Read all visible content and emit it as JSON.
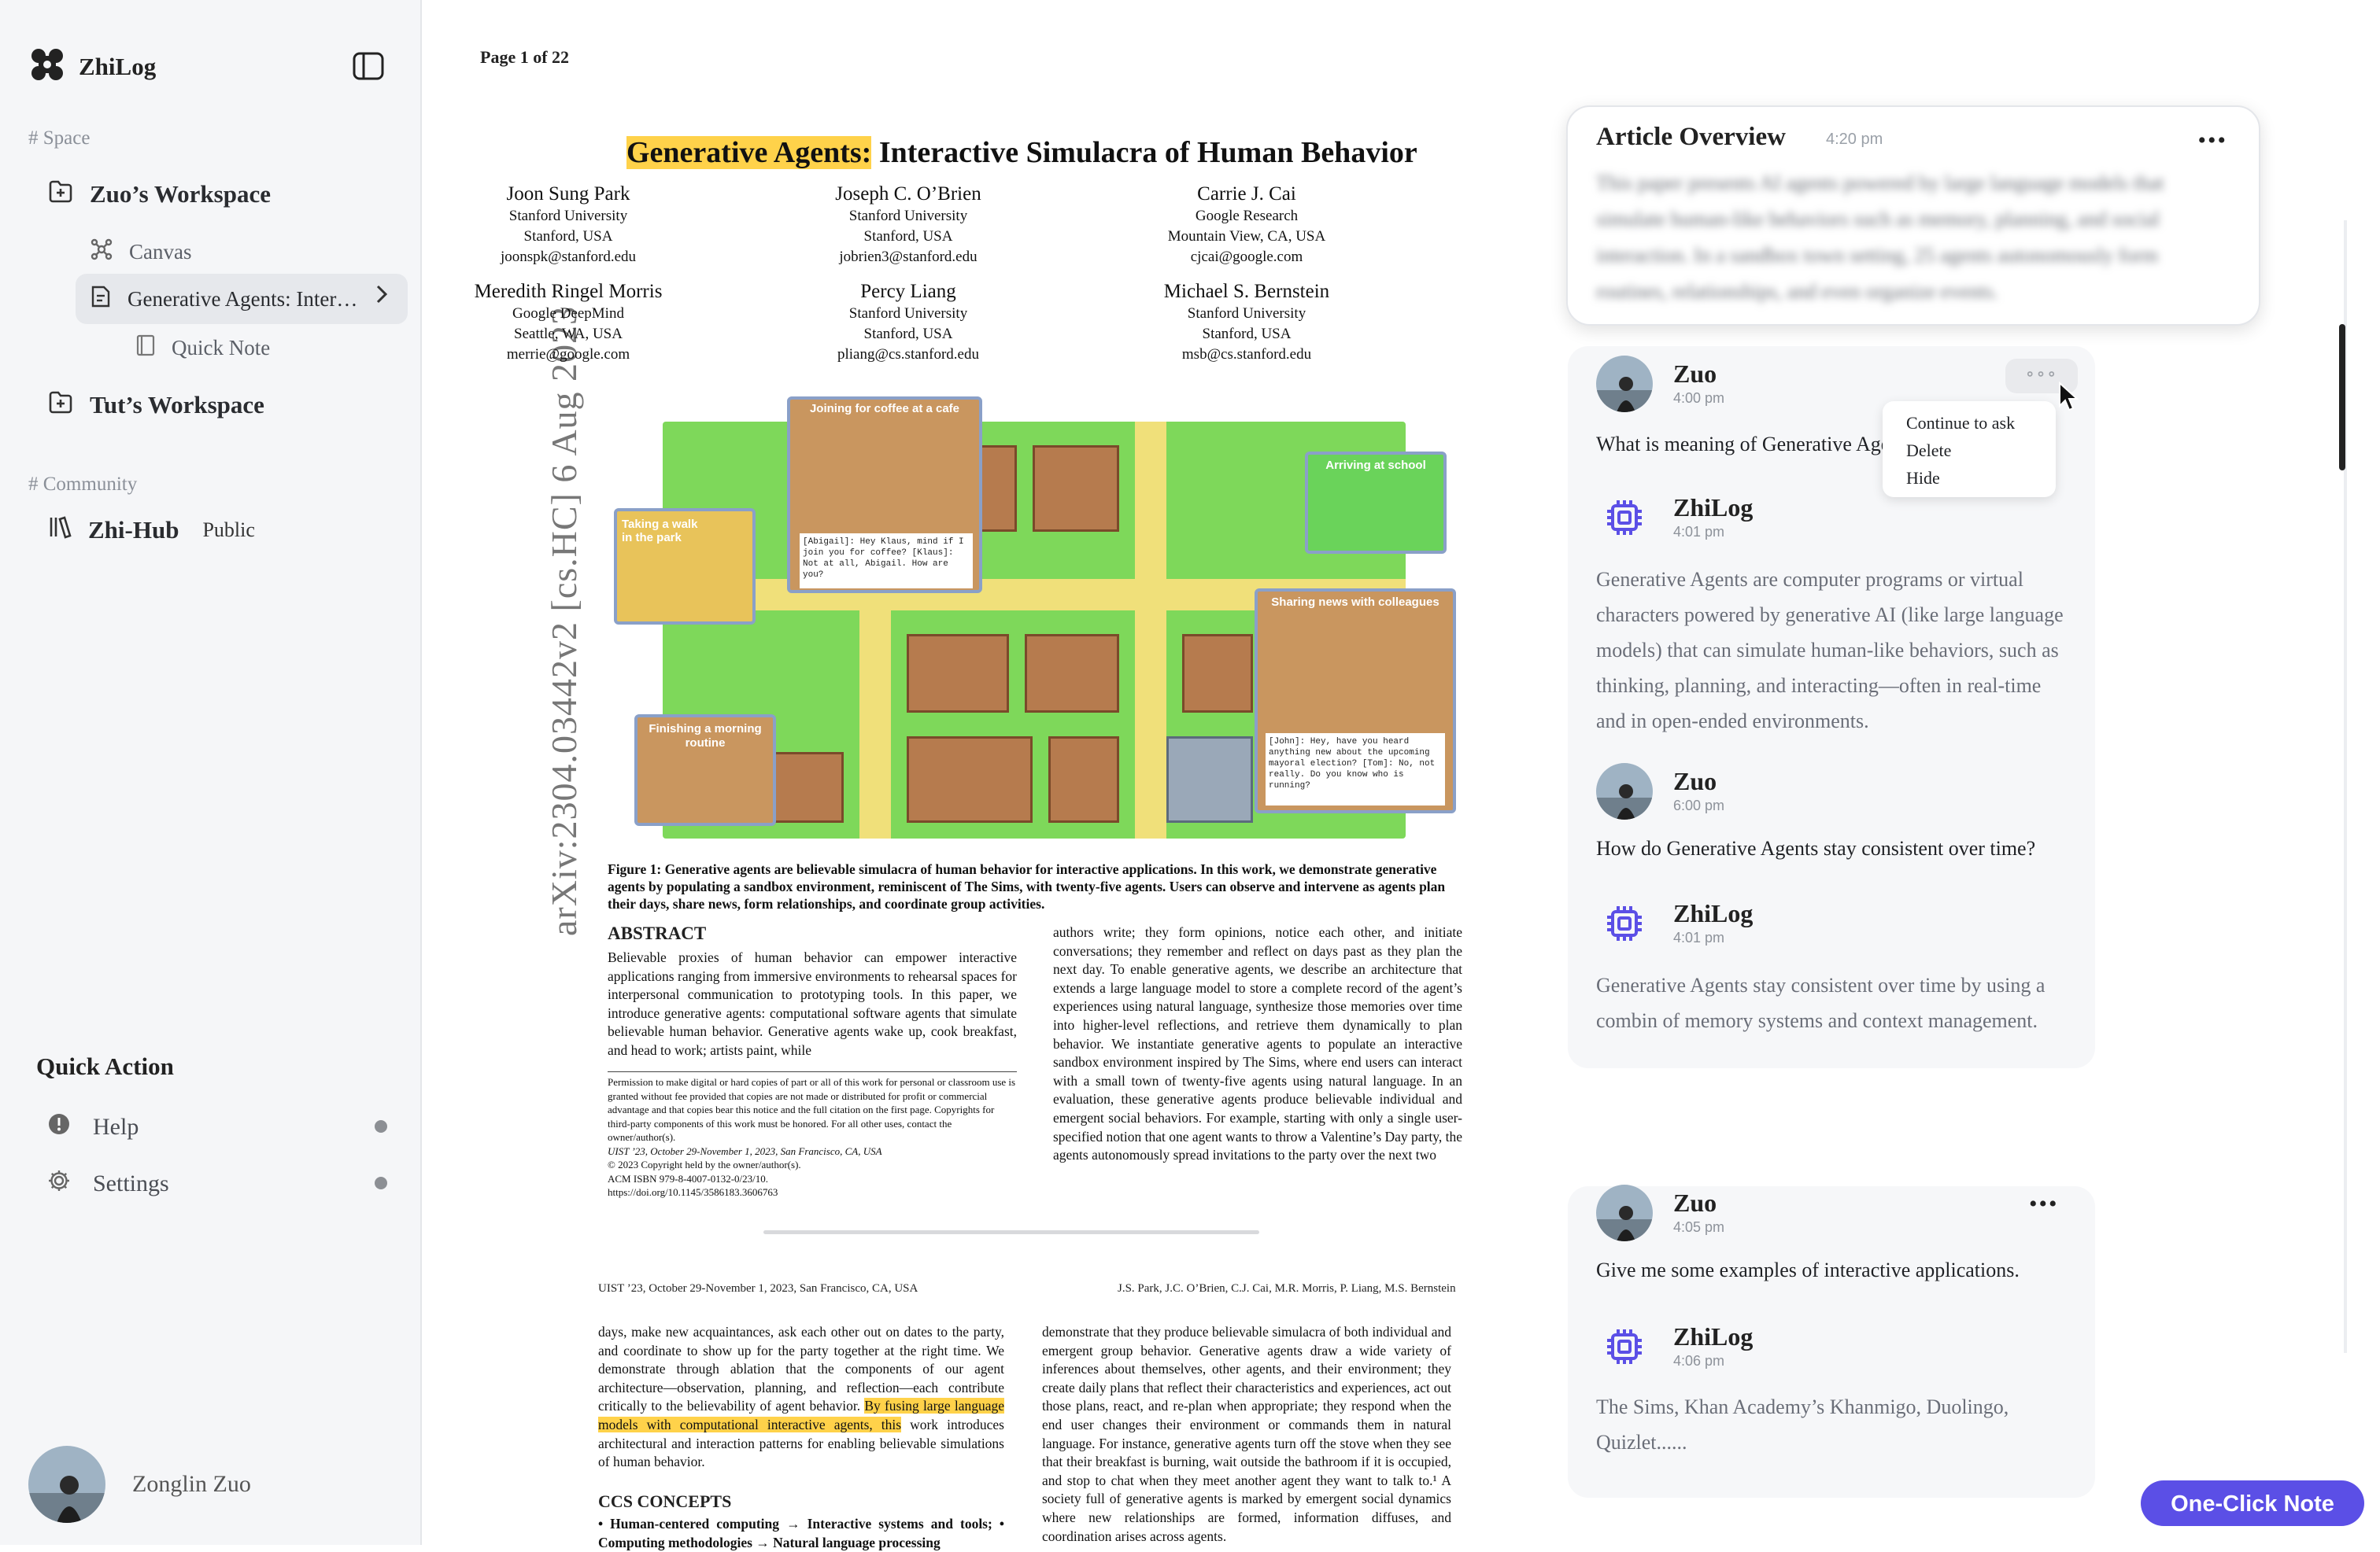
{
  "app": {
    "name": "ZhiLog"
  },
  "sidebar": {
    "space_label": "# Space",
    "workspace_1": "Zuo’s Workspace",
    "canvas": "Canvas",
    "active_doc": "Generative Agents: Inter…",
    "quick_note": "Quick Note",
    "workspace_2": "Tut’s Workspace",
    "community_label": "# Community",
    "hub": "Zhi-Hub",
    "hub_badge": "Public",
    "quick_action_title": "Quick Action",
    "help": "Help",
    "settings": "Settings",
    "user_name": "Zonglin Zuo"
  },
  "doc": {
    "page_indicator": "Page 1 of 22",
    "arxiv": "arXiv:2304.03442v2  [cs.HC]  6 Aug 2023",
    "title_highlight": "Generative Agents:",
    "title_rest": " Interactive Simulacra of Human Behavior",
    "authors": [
      {
        "name": "Joon Sung Park",
        "l1": "Stanford University",
        "l2": "Stanford, USA",
        "l3": "joonspk@stanford.edu"
      },
      {
        "name": "Joseph C. O’Brien",
        "l1": "Stanford University",
        "l2": "Stanford, USA",
        "l3": "jobrien3@stanford.edu"
      },
      {
        "name": "Carrie J. Cai",
        "l1": "Google Research",
        "l2": "Mountain View, CA, USA",
        "l3": "cjcai@google.com"
      },
      {
        "name": "Meredith Ringel Morris",
        "l1": "Google DeepMind",
        "l2": "Seattle, WA, USA",
        "l3": "merrie@google.com"
      },
      {
        "name": "Percy Liang",
        "l1": "Stanford University",
        "l2": "Stanford, USA",
        "l3": "pliang@cs.stanford.edu"
      },
      {
        "name": "Michael S. Bernstein",
        "l1": "Stanford University",
        "l2": "Stanford, USA",
        "l3": "msb@cs.stanford.edu"
      }
    ],
    "figure": {
      "coffee": "Joining for coffee at a cafe",
      "coffee_dialog": "[Abigail]: Hey Klaus, mind if I join you for coffee? [Klaus]: Not at all, Abigail. How are you?",
      "walk": "Taking a walk in the park",
      "school": "Arriving at school",
      "news": "Sharing news with colleagues",
      "news_dialog": "[John]: Hey, have you heard anything new about the upcoming mayoral election? [Tom]: No, not really. Do you know who is running?",
      "routine": "Finishing a morning routine"
    },
    "caption": "Figure 1: Generative agents are believable simulacra of human behavior for interactive applications. In this work, we demonstrate generative agents by populating a sandbox environment, reminiscent of The Sims, with twenty-five agents. Users can observe and intervene as agents plan their days, share news, form relationships, and coordinate group activities.",
    "abstract_heading": "ABSTRACT",
    "abstract_left": "Believable proxies of human behavior can empower interactive applications ranging from immersive environments to rehearsal spaces for interpersonal communication to prototyping tools. In this paper, we introduce generative agents: computational software agents that simulate believable human behavior. Generative agents wake up, cook breakfast, and head to work; artists paint, while",
    "permission": "Permission to make digital or hard copies of part or all of this work for personal or classroom use is granted without fee provided that copies are not made or distributed for profit or commercial advantage and that copies bear this notice and the full citation on the first page. Copyrights for third-party components of this work must be honored. For all other uses, contact the owner/author(s).",
    "uist": "UIST ’23, October 29-November 1, 2023, San Francisco, CA, USA",
    "copyright": "© 2023 Copyright held by the owner/author(s).",
    "isbn": "ACM ISBN 979-8-4007-0132-0/23/10.",
    "doi": "https://doi.org/10.1145/3586183.3606763",
    "abstract_right": "authors write; they form opinions, notice each other, and initiate conversations; they remember and reflect on days past as they plan the next day. To enable generative agents, we describe an architecture that extends a large language model to store a complete record of the agent’s experiences using natural language, synthesize those memories over time into higher-level reflections, and retrieve them dynamically to plan behavior. We instantiate generative agents to populate an interactive sandbox environment inspired by The Sims, where end users can interact with a small town of twenty-five agents using natural language. In an evaluation, these generative agents produce believable individual and emergent social behaviors. For example, starting with only a single user-specified notion that one agent wants to throw a Valentine’s Day party, the agents autonomously spread invitations to the party over the next two",
    "p2_head_left": "UIST ’23, October 29-November 1, 2023, San Francisco, CA, USA",
    "p2_head_right": "J.S. Park, J.C. O’Brien, C.J. Cai, M.R. Morris, P. Liang, M.S. Bernstein",
    "p2_left_a": "days, make new acquaintances, ask each other out on dates to the party, and coordinate to show up for the party together at the right time. We demonstrate through ablation that the components of our agent architecture—observation, planning, and reflection—each contribute critically to the believability of agent behavior. ",
    "p2_left_hl": "By fusing large language models with computational interactive agents, this",
    "p2_left_b": " work introduces architectural and interaction patterns for enabling believable simulations of human behavior.",
    "ccs_heading": "CCS CONCEPTS",
    "ccs_text": "• Human-centered computing → Interactive systems and tools; • Computing methodologies → Natural language processing",
    "p2_right": "demonstrate that they produce believable simulacra of both individual and emergent group behavior. Generative agents draw a wide variety of inferences about themselves, other agents, and their environment; they create daily plans that reflect their characteristics and experiences, act out those plans, react, and re-plan when appropriate; they respond when the end user changes their environment or commands them in natural language. For instance, generative agents turn off the stove when they see that their breakfast is burning, wait outside the bathroom if it is occupied, and stop to chat when they meet another agent they want to talk to.¹ A society full of generative agents is marked by emergent social dynamics where new relationships are formed, information diffuses, and coordination arises across agents."
  },
  "overview": {
    "title": "Article Overview",
    "time": "4:20 pm",
    "text": "This paper presents AI agents powered by large language models that simulate human-like behaviors such as memory, planning, and social interaction. In a sandbox town setting, 25 agents autonomously form routines, relationships, and even organize events."
  },
  "chat": {
    "thread1": [
      {
        "who": "Zuo",
        "time": "4:00 pm",
        "text": "What is meaning of Generative Agents in this article?"
      },
      {
        "who": "ZhiLog",
        "time": "4:01 pm",
        "text": "Generative Agents are computer programs or virtual characters powered by generative AI (like large language models) that can simulate human-like behaviors, such as thinking, planning, and interacting—often in real-time and in open-ended environments."
      },
      {
        "who": "Zuo",
        "time": "6:00 pm",
        "text": "How do Generative Agents stay consistent over time?"
      },
      {
        "who": "ZhiLog",
        "time": "4:01 pm",
        "text": "Generative Agents stay consistent over time by using a combin of memory systems and context management."
      }
    ],
    "thread2": [
      {
        "who": "Zuo",
        "time": "4:05 pm",
        "text": "Give me some examples of interactive applications."
      },
      {
        "who": "ZhiLog",
        "time": "4:06 pm",
        "text": "The Sims, Khan Academy’s Khanmigo, Duolingo, Quizlet......"
      }
    ],
    "menu": [
      "Continue to ask",
      "Delete",
      "Hide"
    ],
    "more": "∘∘∘",
    "dots": "•••"
  },
  "actions": {
    "one_click_note": "One-Click Note"
  },
  "colors": {
    "accent": "#5b4fe6",
    "highlight": "#ffd24a",
    "bot_icon": "#5b4fe6"
  }
}
